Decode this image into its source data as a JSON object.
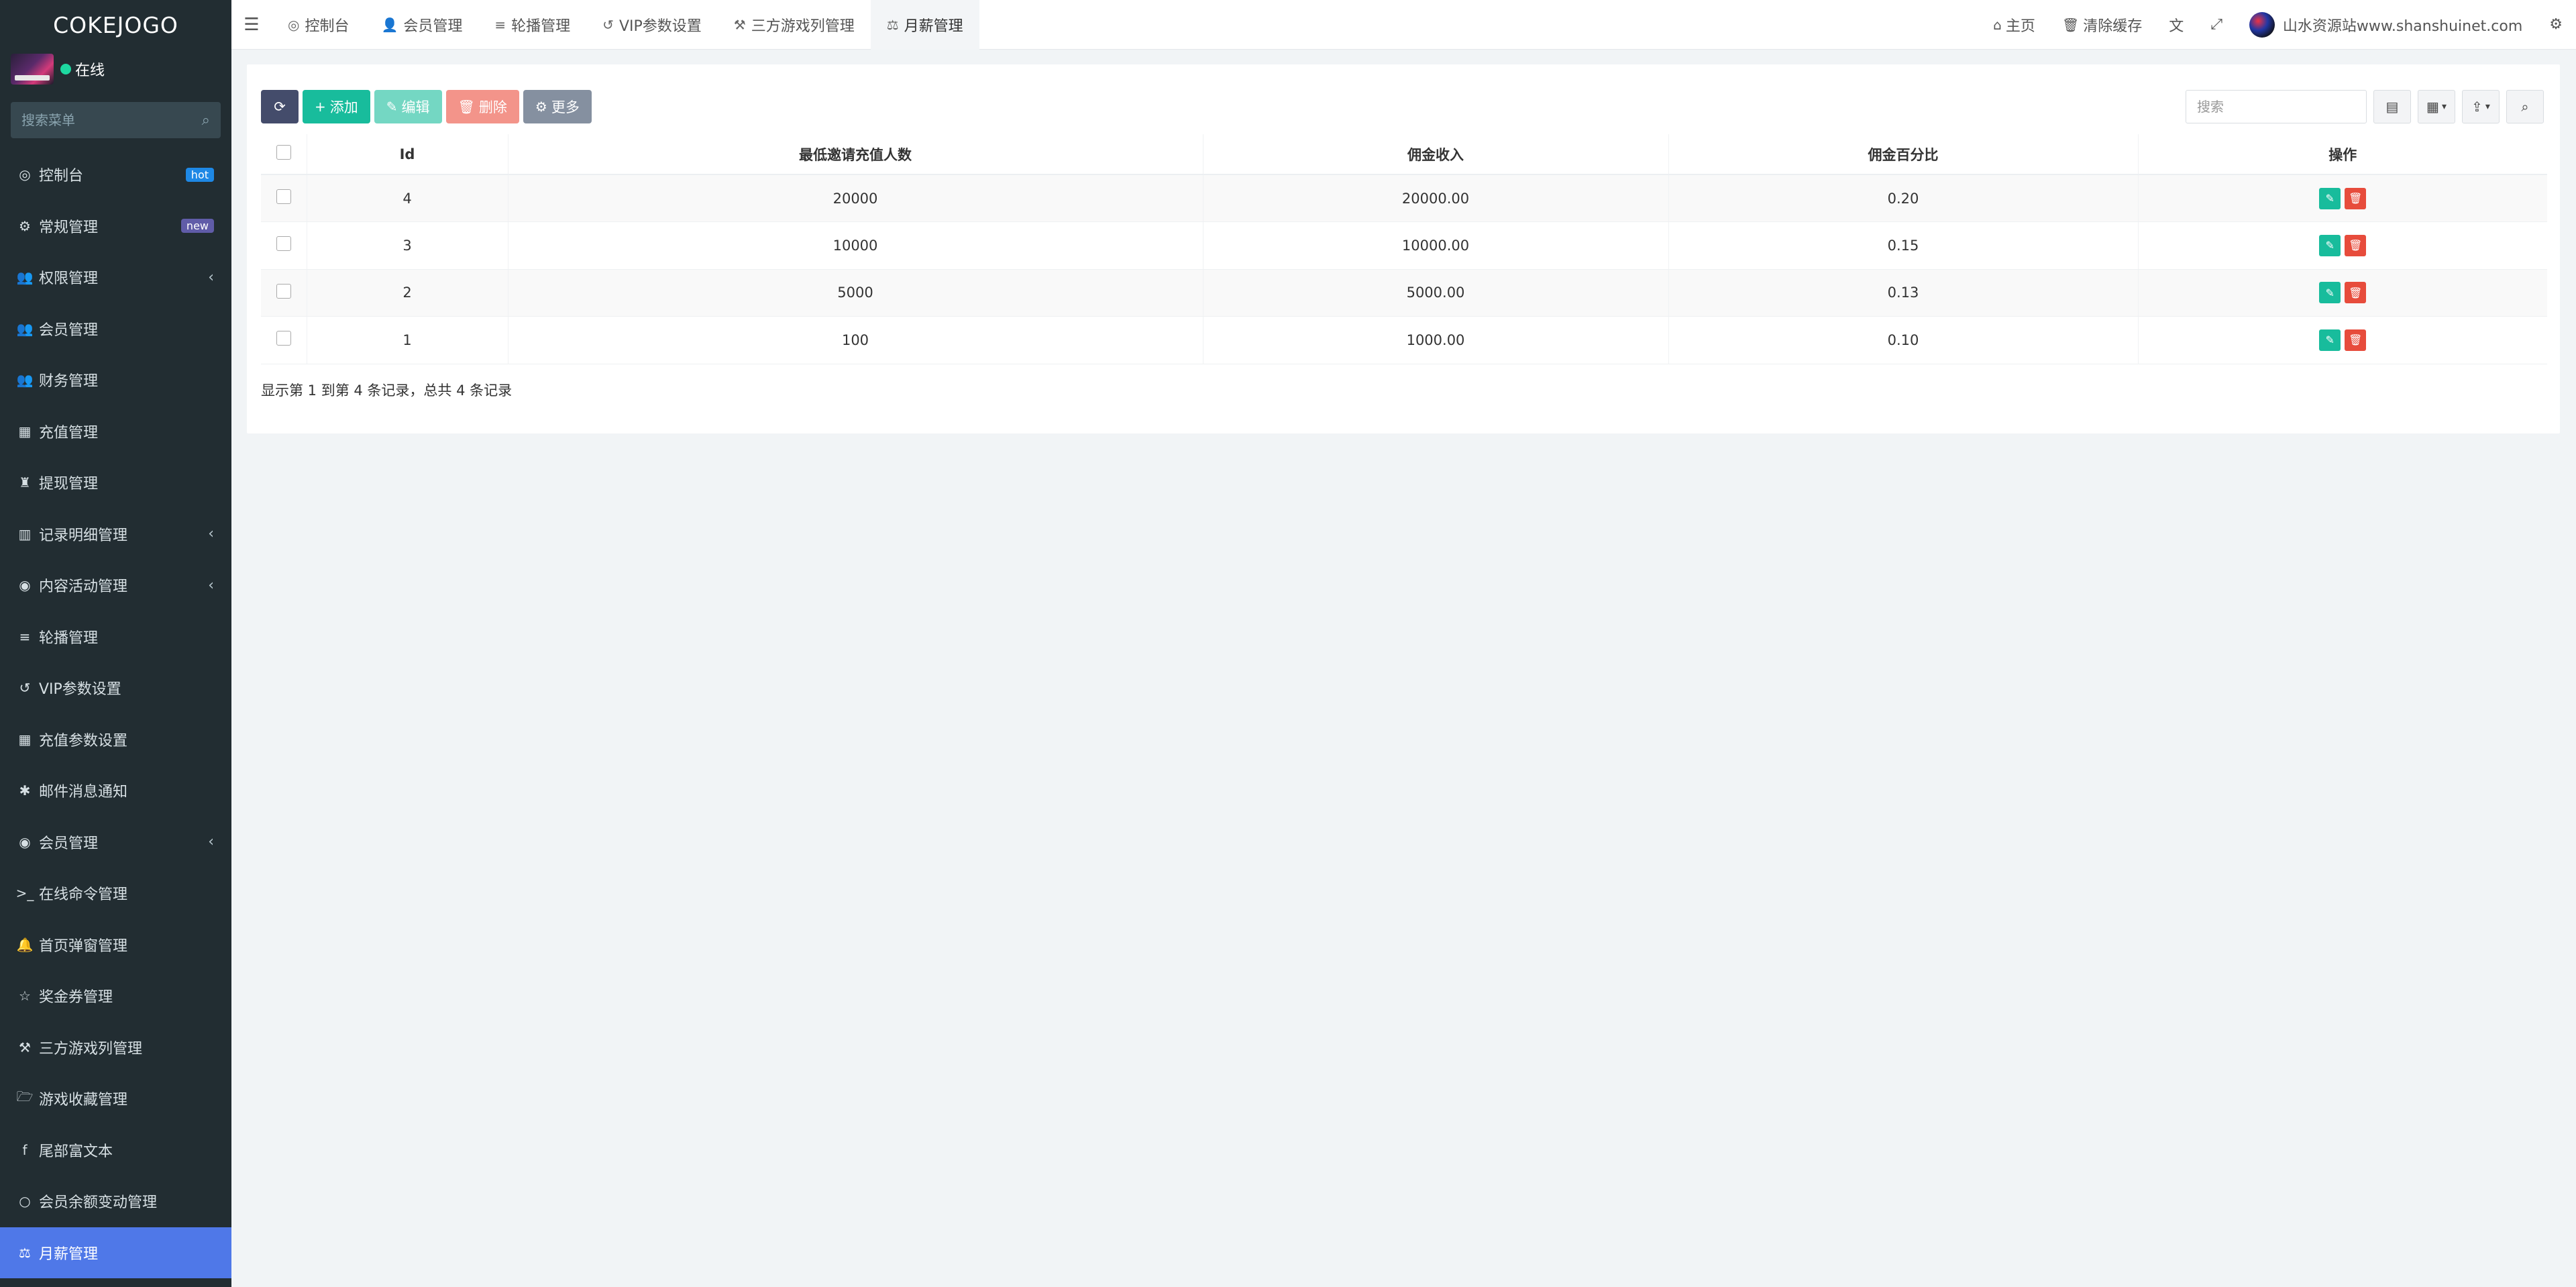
{
  "sidebar": {
    "logo": "COKEJOGO",
    "status": "在线",
    "search_placeholder": "搜索菜单",
    "items": [
      {
        "label": "控制台",
        "icon": "dashboard-icon",
        "glyph": "◎",
        "badge": "hot"
      },
      {
        "label": "常规管理",
        "icon": "cogs-icon",
        "glyph": "⚙",
        "badge": "new"
      },
      {
        "label": "权限管理",
        "icon": "group-icon",
        "glyph": "👥",
        "chevron": "‹"
      },
      {
        "label": "会员管理",
        "icon": "users-icon",
        "glyph": "👥"
      },
      {
        "label": "财务管理",
        "icon": "users-icon",
        "glyph": "👥"
      },
      {
        "label": "充值管理",
        "icon": "th-large-icon",
        "glyph": "▦"
      },
      {
        "label": "提现管理",
        "icon": "chess-icon",
        "glyph": "♜"
      },
      {
        "label": "记录明细管理",
        "icon": "bar-chart-icon",
        "glyph": "▥",
        "chevron": "‹"
      },
      {
        "label": "内容活动管理",
        "icon": "spotify-icon",
        "glyph": "◉",
        "chevron": "‹"
      },
      {
        "label": "轮播管理",
        "icon": "bars-icon",
        "glyph": "≡"
      },
      {
        "label": "VIP参数设置",
        "icon": "history-icon",
        "glyph": "↺"
      },
      {
        "label": "充值参数设置",
        "icon": "th-icon",
        "glyph": "▦"
      },
      {
        "label": "邮件消息通知",
        "icon": "asterisk-icon",
        "glyph": "✱"
      },
      {
        "label": "会员管理",
        "icon": "user-circle-icon",
        "glyph": "◉",
        "chevron": "‹"
      },
      {
        "label": "在线命令管理",
        "icon": "terminal-icon",
        "glyph": ">_"
      },
      {
        "label": "首页弹窗管理",
        "icon": "bell-icon",
        "glyph": "🔔"
      },
      {
        "label": "奖金券管理",
        "icon": "star-icon",
        "glyph": "☆"
      },
      {
        "label": "三方游戏列管理",
        "icon": "gavel-icon",
        "glyph": "⚒"
      },
      {
        "label": "游戏收藏管理",
        "icon": "folder-open-icon",
        "glyph": "🗁"
      },
      {
        "label": "尾部富文本",
        "icon": "facebook-icon",
        "glyph": "f"
      },
      {
        "label": "会员余额变动管理",
        "icon": "circle-icon",
        "glyph": "○"
      },
      {
        "label": "月薪管理",
        "icon": "balance-scale-icon",
        "glyph": "⚖",
        "active": true
      }
    ]
  },
  "topbar": {
    "tabs": [
      {
        "label": "控制台",
        "icon": "dashboard-icon",
        "glyph": "◎"
      },
      {
        "label": "会员管理",
        "icon": "user-icon",
        "glyph": "👤"
      },
      {
        "label": "轮播管理",
        "icon": "bars-icon",
        "glyph": "≡"
      },
      {
        "label": "VIP参数设置",
        "icon": "history-icon",
        "glyph": "↺"
      },
      {
        "label": "三方游戏列管理",
        "icon": "gavel-icon",
        "glyph": "⚒"
      },
      {
        "label": "月薪管理",
        "icon": "balance-scale-icon",
        "glyph": "⚖",
        "active": true
      }
    ],
    "home": "主页",
    "clear_cache": "清除缓存",
    "username": "山水资源站www.shanshuinet.com"
  },
  "toolbar": {
    "add": "添加",
    "edit": "编辑",
    "delete": "删除",
    "more": "更多",
    "search_placeholder": "搜索"
  },
  "table": {
    "headers": [
      "Id",
      "最低邀请充值人数",
      "佣金收入",
      "佣金百分比",
      "操作"
    ],
    "rows": [
      [
        "4",
        "20000",
        "20000.00",
        "0.20"
      ],
      [
        "3",
        "10000",
        "10000.00",
        "0.15"
      ],
      [
        "2",
        "5000",
        "5000.00",
        "0.13"
      ],
      [
        "1",
        "100",
        "1000.00",
        "0.10"
      ]
    ]
  },
  "summary": "显示第 1 到第 4 条记录，总共 4 条记录"
}
